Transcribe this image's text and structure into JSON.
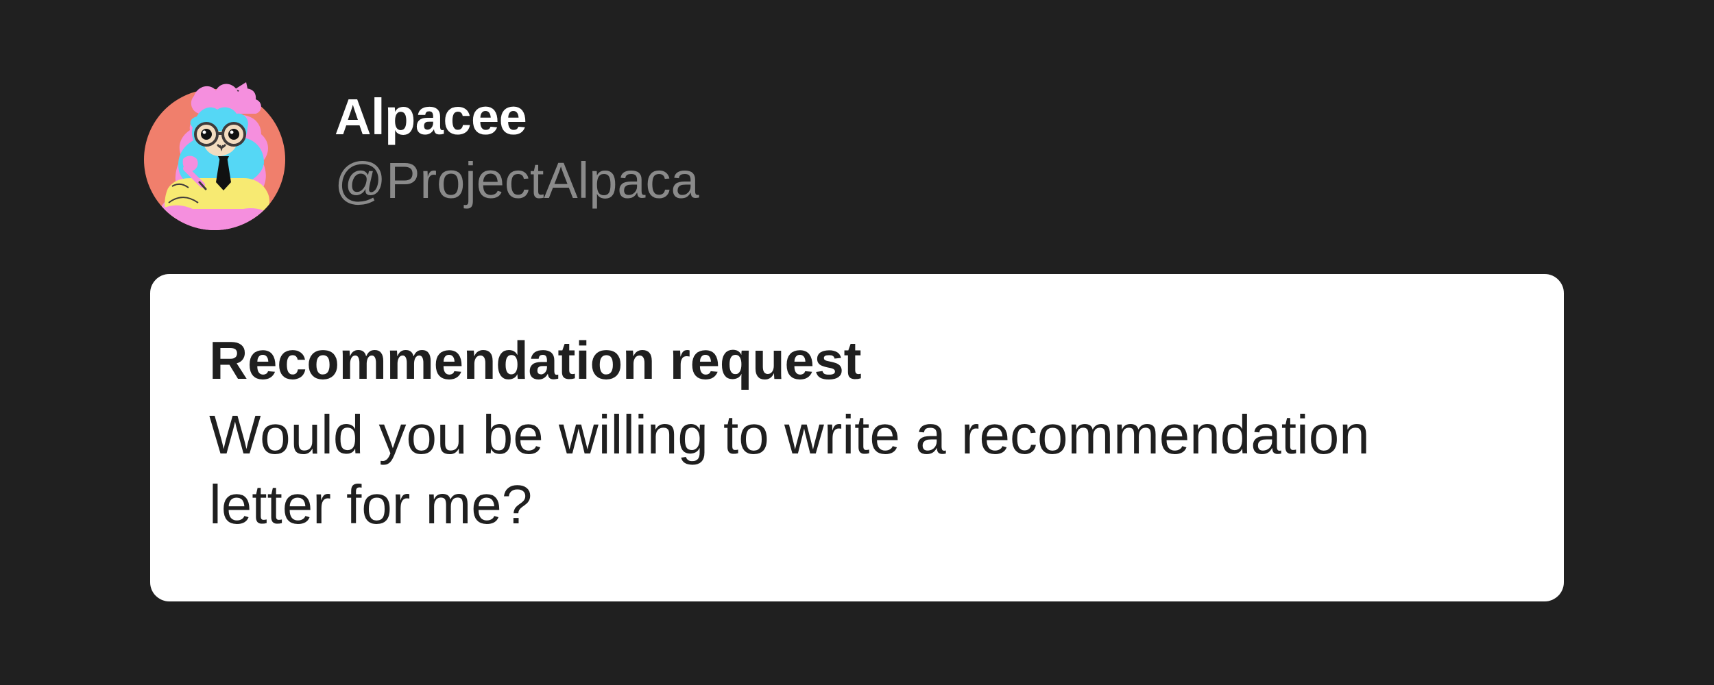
{
  "user": {
    "display_name": "Alpacee",
    "handle": "@ProjectAlpaca"
  },
  "avatar": {
    "icon": "alpaca-avatar-icon",
    "colors": {
      "background": "#f07f6c",
      "pink": "#f58fde",
      "cyan": "#55d7f5",
      "yellow": "#f7ea72",
      "face": "#f3dcc0",
      "tie": "#111111"
    }
  },
  "message": {
    "title": "Recommendation request",
    "body": "Would you be willing to write a recommendation letter for me?"
  },
  "colors": {
    "page_background": "#202020",
    "card_background": "#ffffff",
    "primary_text_dark": "#1f1f1f",
    "primary_text_light": "#ffffff",
    "secondary_text": "#8a8a8a"
  }
}
